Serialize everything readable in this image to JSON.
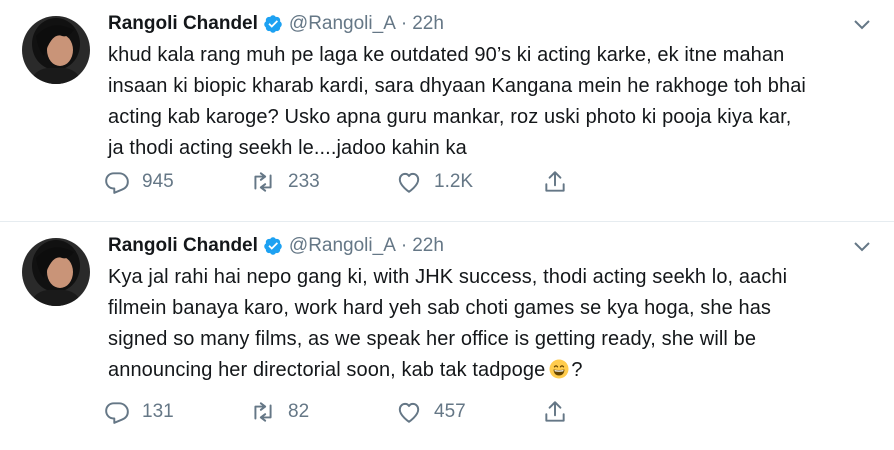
{
  "tweets": [
    {
      "name": "Rangoli Chandel",
      "handle": "@Rangoli_A",
      "separator": "·",
      "time": "22h",
      "lines": [
        "khud kala rang muh pe laga ke outdated 90’s ki acting karke, ek itne mahan",
        "insaan ki biopic kharab kardi, sara dhyaan Kangana mein he rakhoge toh bhai",
        "acting kab karoge? Usko apna guru mankar, roz uski photo ki pooja kiya kar,",
        "ja thodi acting seekh le....jadoo kahin ka"
      ],
      "emoji_line_suffix": "",
      "replies": "945",
      "retweets": "233",
      "likes": "1.2K"
    },
    {
      "name": "Rangoli Chandel",
      "handle": "@Rangoli_A",
      "separator": "·",
      "time": "22h",
      "lines": [
        "Kya jal rahi hai nepo gang ki, with JHK success, thodi acting seekh lo, aachi",
        "filmein banaya karo, work hard yeh sab choti games se kya hoga, she has",
        "signed so many films, as we speak her office is getting ready, she will be",
        "announcing her directorial soon, kab tak tadpoge"
      ],
      "emoji_line_suffix": "?",
      "replies": "131",
      "retweets": "82",
      "likes": "457"
    }
  ],
  "icons": {
    "reply": "reply-icon",
    "retweet": "retweet-icon",
    "like": "heart-icon",
    "share": "share-icon",
    "verified": "verified-badge-icon",
    "caret": "chevron-down-icon",
    "emoji": "grinning-emoji-icon"
  },
  "colors": {
    "text": "#14171a",
    "secondary": "#657786",
    "verified": "#1da1f2",
    "divider": "#e6ecf0"
  }
}
